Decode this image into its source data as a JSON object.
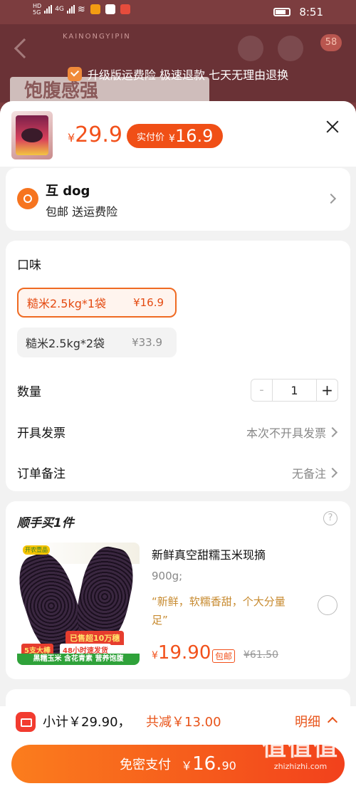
{
  "statusbar": {
    "net1": "HD",
    "net2": "5G",
    "net3": "4G",
    "time": "8:51"
  },
  "background": {
    "brand_text": "KAINONGYIPIN",
    "cart_badge": "58",
    "ad_text": "饱腹感强"
  },
  "promo_bar": {
    "text": "升级版运费险 极速退款 七天无理由退换"
  },
  "product": {
    "currency": "¥",
    "price": "29.9",
    "actual_label": "实付价",
    "actual_currency": "¥",
    "actual_price": "16.9"
  },
  "address": {
    "name": "互 dog",
    "sub": "包邮  送运费险"
  },
  "spec": {
    "title": "口味",
    "options": [
      {
        "name": "糙米2.5kg*1袋",
        "price": "¥16.9",
        "selected": true
      },
      {
        "name": "糙米2.5kg*2袋",
        "price": "¥33.9",
        "selected": false
      }
    ],
    "qty_label": "数量",
    "qty_minus": "-",
    "qty_value": "1",
    "qty_plus": "+",
    "invoice_label": "开具发票",
    "invoice_value": "本次不开具发票",
    "note_label": "订单备注",
    "note_value": "无备注"
  },
  "upsell": {
    "title": "顺手买1件",
    "help": "?",
    "image_tags": {
      "logo": "开农壹品",
      "sold": "已售超10万穗",
      "a": "5支大棒",
      "b": "48小时速发货",
      "c": "黑糯玉米 含花青素 营养饱腹"
    },
    "name": "新鲜真空甜糯玉米现摘",
    "weight": "900g;",
    "desc": "“新鲜，软糯香甜，个大分量足”",
    "currency": "¥",
    "price": "19.90",
    "mail_tag": "包邮",
    "orig_price": "¥61.50"
  },
  "footer": {
    "subtotal": "小计￥29.90，",
    "discount": "共减￥13.00",
    "detail": "明细",
    "pay_label": "免密支付",
    "pay_currency": "￥",
    "pay_int": "16.",
    "pay_dec": "90"
  },
  "watermark": {
    "big": "值值值",
    "url": "zhizhizhi.com"
  },
  "colors": {
    "accent": "#f2511b",
    "pay_gradient_start": "#fb7d1d",
    "pay_gradient_end": "#f2411c",
    "upsell_desc": "#c78a2f"
  }
}
